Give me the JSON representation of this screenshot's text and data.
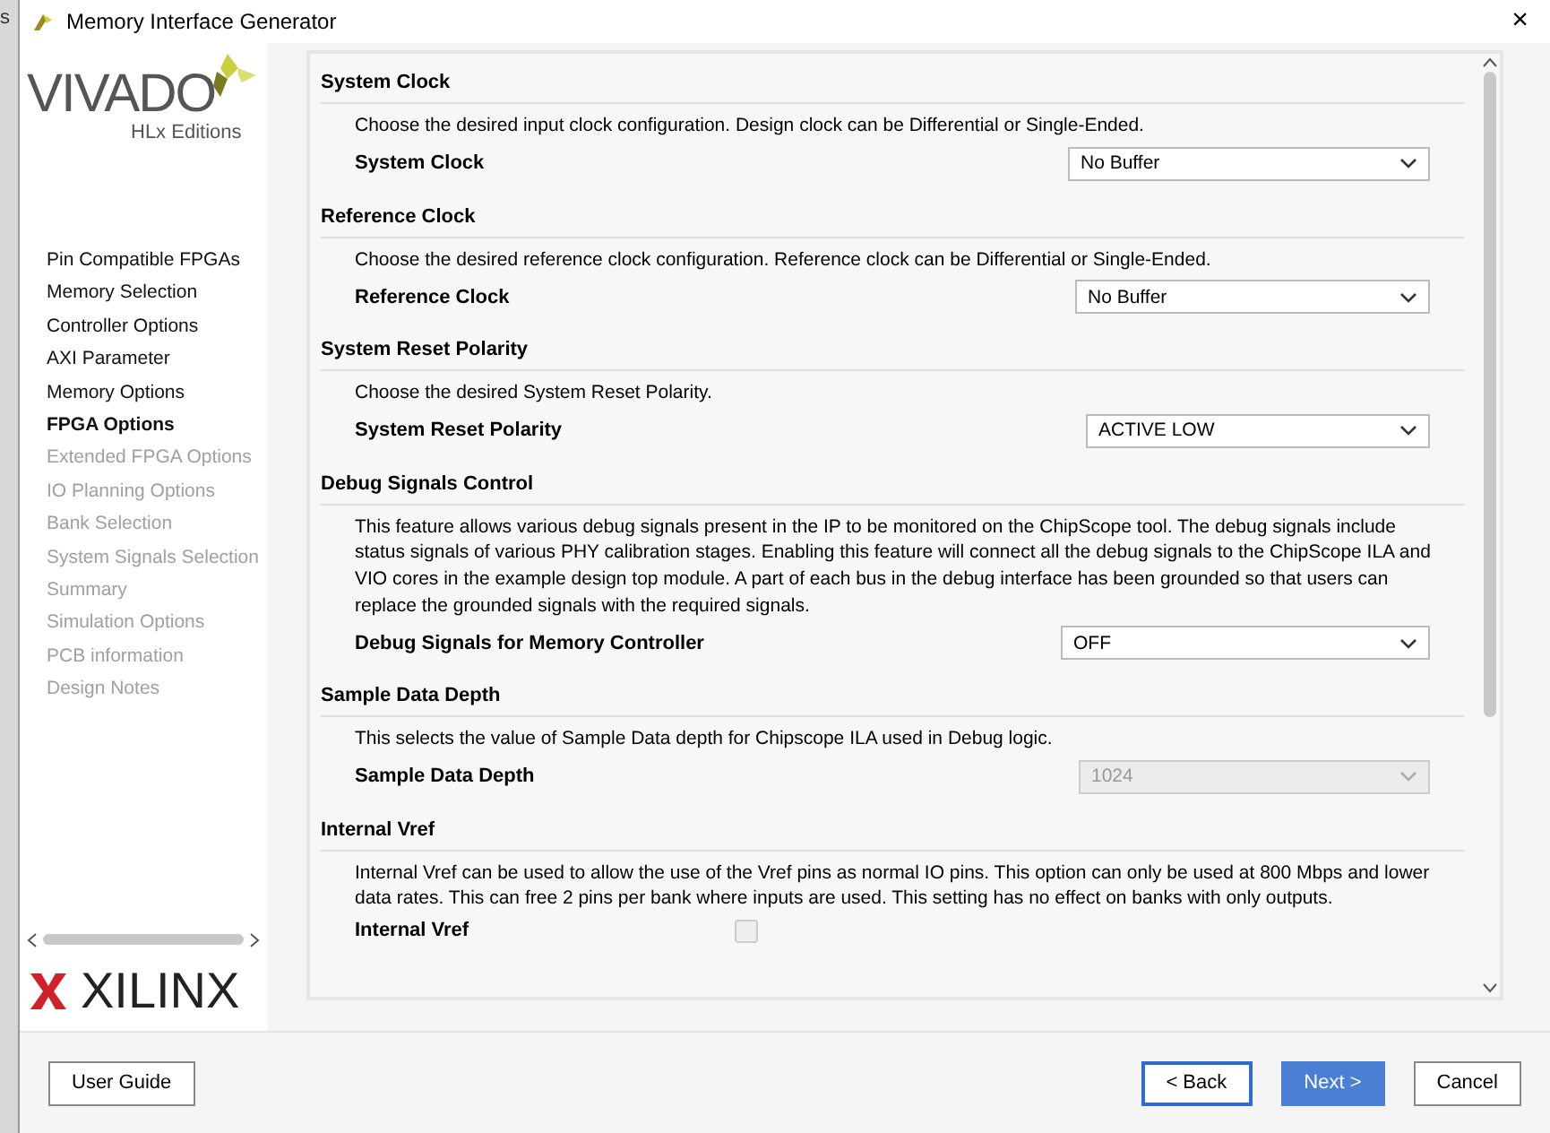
{
  "background_window": {
    "text": "s"
  },
  "window": {
    "title": "Memory Interface Generator",
    "close": "×"
  },
  "logo": {
    "name": "VIVADO",
    "subtitle": "HLx Editions",
    "vendor": "XILINX"
  },
  "sidebar": {
    "items": [
      {
        "label": "Pin Compatible FPGAs",
        "selected": false,
        "disabled": false
      },
      {
        "label": "Memory Selection",
        "selected": false,
        "disabled": false
      },
      {
        "label": "Controller Options",
        "selected": false,
        "disabled": false
      },
      {
        "label": "AXI Parameter",
        "selected": false,
        "disabled": false
      },
      {
        "label": "Memory Options",
        "selected": false,
        "disabled": false
      },
      {
        "label": "FPGA Options",
        "selected": true,
        "disabled": false
      },
      {
        "label": "Extended FPGA Options",
        "selected": false,
        "disabled": true
      },
      {
        "label": "IO Planning Options",
        "selected": false,
        "disabled": true
      },
      {
        "label": "Bank Selection",
        "selected": false,
        "disabled": true
      },
      {
        "label": "System Signals Selection",
        "selected": false,
        "disabled": true
      },
      {
        "label": "Summary",
        "selected": false,
        "disabled": true
      },
      {
        "label": "Simulation Options",
        "selected": false,
        "disabled": true
      },
      {
        "label": "PCB information",
        "selected": false,
        "disabled": true
      },
      {
        "label": "Design Notes",
        "selected": false,
        "disabled": true
      }
    ]
  },
  "sections": [
    {
      "heading": "System Clock",
      "description": "Choose the desired input clock configuration. Design clock can be Differential or Single-Ended.",
      "field": {
        "kind": "select",
        "label": "System Clock",
        "value": "No Buffer",
        "disabled": false
      }
    },
    {
      "heading": "Reference Clock",
      "description": "Choose the desired reference clock configuration. Reference clock can be Differential or Single-Ended.",
      "field": {
        "kind": "select",
        "label": "Reference Clock",
        "value": "No Buffer",
        "disabled": false
      }
    },
    {
      "heading": "System Reset Polarity",
      "description": "Choose the desired System Reset Polarity.",
      "field": {
        "kind": "select",
        "label": "System Reset Polarity",
        "value": "ACTIVE LOW",
        "disabled": false
      }
    },
    {
      "heading": "Debug Signals Control",
      "description": "This feature allows various debug signals present in the IP to be monitored on the ChipScope tool. The debug signals include status signals of various PHY calibration stages. Enabling this feature will connect all the debug signals to the ChipScope ILA and VIO cores in the example design top module. A part of each bus in the debug interface has been grounded so that users can replace the grounded signals with the required signals.",
      "field": {
        "kind": "select",
        "label": "Debug Signals for Memory Controller",
        "value": "OFF",
        "disabled": false
      }
    },
    {
      "heading": "Sample Data Depth",
      "description": "This selects the value of Sample Data depth for Chipscope ILA used in Debug logic.",
      "field": {
        "kind": "select",
        "label": "Sample Data Depth",
        "value": "1024",
        "disabled": true
      }
    },
    {
      "heading": "Internal Vref",
      "description": "Internal Vref can be used to allow the use of the Vref pins as normal IO pins. This option can only be used at 800 Mbps and lower data rates. This can free 2 pins per bank where inputs are used. This setting has no effect on banks with only outputs.",
      "field": {
        "kind": "checkbox",
        "label": "Internal Vref",
        "checked": false,
        "disabled": true
      }
    }
  ],
  "footer": {
    "help_button": "User Guide",
    "buttons": [
      {
        "label": "< Back",
        "focused": true,
        "primary": false
      },
      {
        "label": "Next >",
        "focused": false,
        "primary": true
      },
      {
        "label": "Cancel",
        "focused": false,
        "primary": false
      }
    ]
  }
}
